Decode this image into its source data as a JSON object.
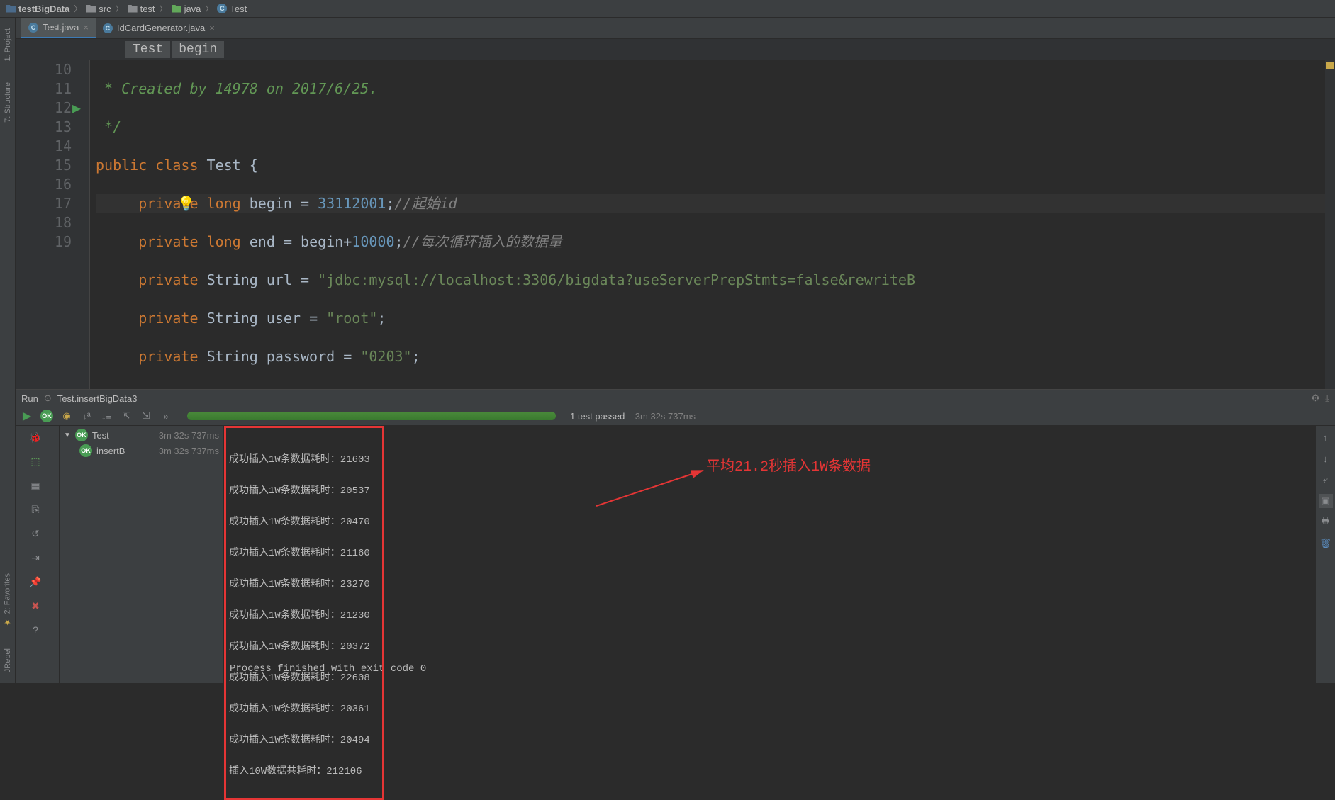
{
  "breadcrumb": [
    {
      "icon": "folder-blue",
      "label": "testBigData"
    },
    {
      "icon": "folder",
      "label": "src"
    },
    {
      "icon": "folder",
      "label": "test"
    },
    {
      "icon": "folder-green",
      "label": "java"
    },
    {
      "icon": "class",
      "label": "Test"
    }
  ],
  "left_rail": {
    "project": "1: Project",
    "structure": "7: Structure",
    "favorites": "2: Favorites",
    "jrebel": "JRebel"
  },
  "tabs": [
    {
      "label": "Test.java",
      "active": true
    },
    {
      "label": "IdCardGenerator.java",
      "active": false
    }
  ],
  "crumb_nav": [
    "Test",
    "begin"
  ],
  "code": {
    "line_numbers": [
      10,
      11,
      12,
      13,
      14,
      15,
      16,
      17,
      18,
      19
    ],
    "comment_doc": " * Created by 14978 on 2017/6/25.",
    "comment_end": " */",
    "class_decl_kw": "public class",
    "class_name": "Test",
    "begin_comment": "//起始id",
    "begin_val": "33112001",
    "end_comment": "//每次循环插入的数据量",
    "end_val": "10000",
    "url_val": "\"jdbc:mysql://localhost:3306/bigdata?useServerPrepStmts=false&rewriteB",
    "user_val": "\"root\"",
    "password_val": "\"0203\""
  },
  "run": {
    "title": "Run",
    "config": "Test.insertBigData3",
    "summary_label": "1 test passed",
    "summary_time": "3m 32s 737ms",
    "tree": [
      {
        "label": "Test",
        "time": "3m 32s 737ms",
        "level": 0
      },
      {
        "label": "insertB",
        "time": "3m 32s 737ms",
        "level": 1
      }
    ],
    "console_lines": [
      "成功插入1W条数据耗时：21603",
      "成功插入1W条数据耗时：20537",
      "成功插入1W条数据耗时：20470",
      "成功插入1W条数据耗时：21160",
      "成功插入1W条数据耗时：23270",
      "成功插入1W条数据耗时：21230",
      "成功插入1W条数据耗时：20372",
      "成功插入1W条数据耗时：22608",
      "成功插入1W条数据耗时：20361",
      "成功插入1W条数据耗时：20494",
      "插入10W数据共耗时：212106"
    ],
    "process_finished": "Process finished with exit code 0",
    "annotation": "平均21.2秒插入1W条数据"
  }
}
